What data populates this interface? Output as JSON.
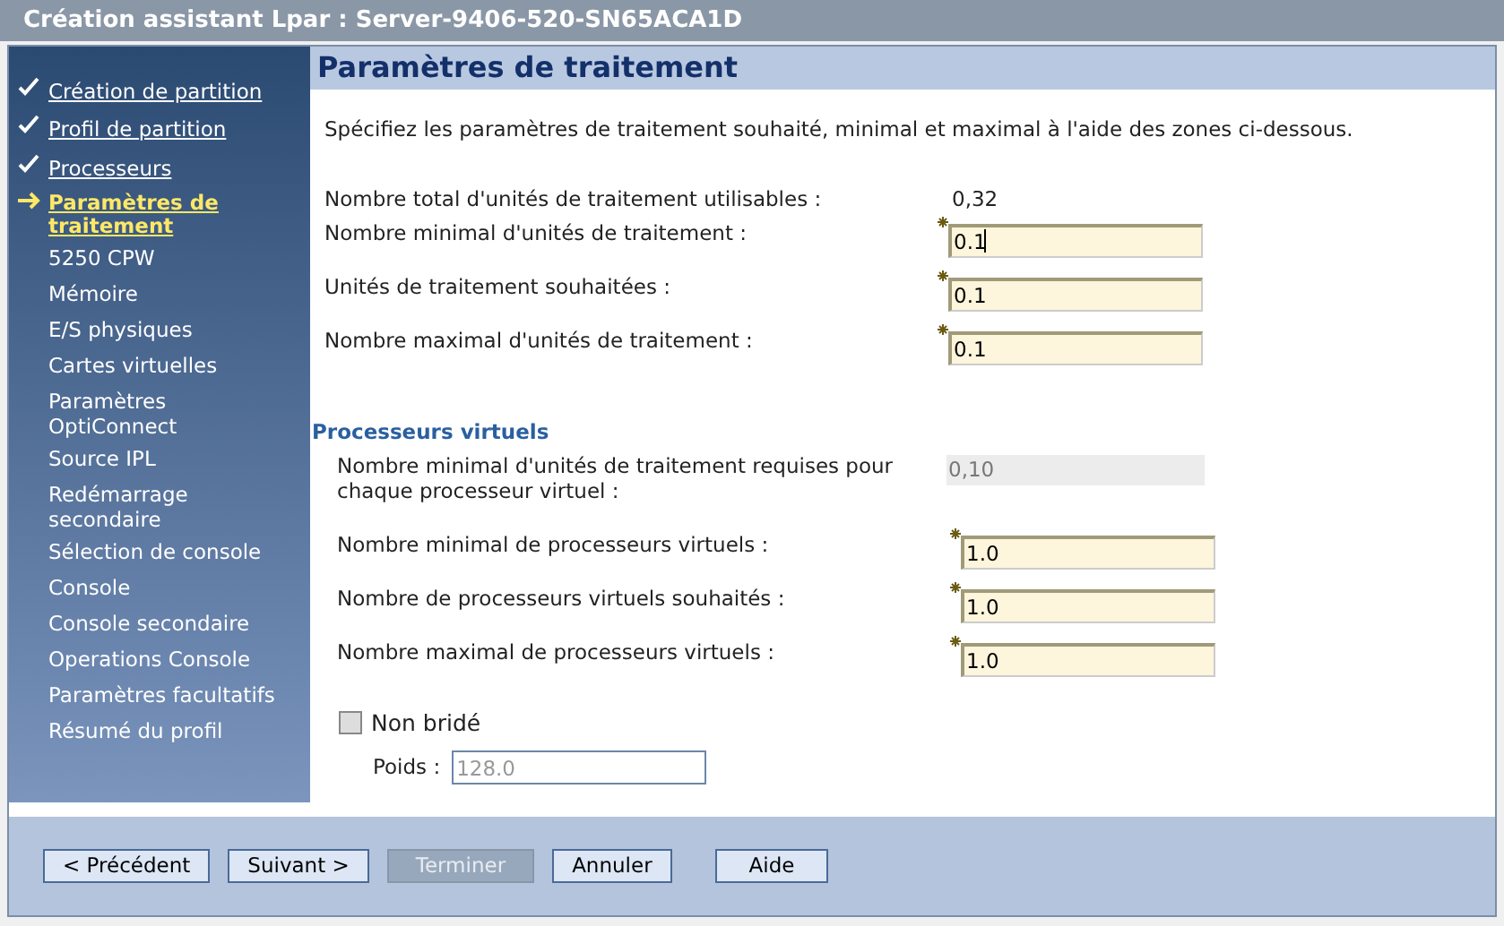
{
  "window": {
    "title": "Création assistant Lpar : Server-9406-520-SN65ACA1D"
  },
  "sidebar": {
    "items": [
      {
        "label": "Création de partition",
        "kind": "done"
      },
      {
        "label": "Profil de partition",
        "kind": "done"
      },
      {
        "label": "Processeurs",
        "kind": "done"
      },
      {
        "label": "Paramètres de traitement",
        "kind": "current"
      },
      {
        "label": "5250 CPW",
        "kind": "pending"
      },
      {
        "label": "Mémoire",
        "kind": "pending"
      },
      {
        "label": "E/S physiques",
        "kind": "pending"
      },
      {
        "label": "Cartes virtuelles",
        "kind": "pending"
      },
      {
        "label": "Paramètres OptiConnect",
        "kind": "pending"
      },
      {
        "label": "Source IPL",
        "kind": "pending"
      },
      {
        "label": "Redémarrage secondaire",
        "kind": "pending"
      },
      {
        "label": "Sélection de console",
        "kind": "pending"
      },
      {
        "label": "Console",
        "kind": "pending"
      },
      {
        "label": "Console secondaire",
        "kind": "pending"
      },
      {
        "label": "Operations Console",
        "kind": "pending"
      },
      {
        "label": "Paramètres facultatifs",
        "kind": "pending"
      },
      {
        "label": "Résumé du profil",
        "kind": "pending"
      }
    ]
  },
  "page": {
    "heading": "Paramètres de traitement",
    "intro": "Spécifiez les paramètres de traitement souhaité, minimal et maximal à l'aide des zones ci-dessous.",
    "total": {
      "label": "Nombre total d'unités de traitement utilisables :",
      "value": "0,32"
    },
    "fields": [
      {
        "label": "Nombre minimal d'unités de traitement :",
        "value": "0.1",
        "required": true,
        "focused": true
      },
      {
        "label": "Unités de traitement souhaitées :",
        "value": "0.1",
        "required": true,
        "focused": false
      },
      {
        "label": "Nombre maximal d'unités de traitement :",
        "value": "0.1",
        "required": true,
        "focused": false
      }
    ]
  },
  "virtual": {
    "heading": "Processeurs virtuels",
    "min_units": {
      "label": "Nombre minimal d'unités de traitement requises pour chaque processeur virtuel :",
      "value": "0,10"
    },
    "fields": [
      {
        "label": "Nombre minimal de processeurs virtuels :",
        "value": "1.0",
        "required": true
      },
      {
        "label": "Nombre de processeurs virtuels souhaités :",
        "value": "1.0",
        "required": true
      },
      {
        "label": "Nombre maximal de processeurs virtuels :",
        "value": "1.0",
        "required": true
      }
    ],
    "uncapped": {
      "label": "Non bridé",
      "checked": false
    },
    "weight": {
      "label": "Poids :",
      "value": "128.0",
      "disabled": true
    }
  },
  "buttons": [
    {
      "label": "< Précédent",
      "disabled": false
    },
    {
      "label": "Suivant >",
      "disabled": false
    },
    {
      "label": "Terminer",
      "disabled": true
    },
    {
      "label": "Annuler",
      "disabled": false
    },
    {
      "label": "Aide",
      "disabled": false
    }
  ]
}
